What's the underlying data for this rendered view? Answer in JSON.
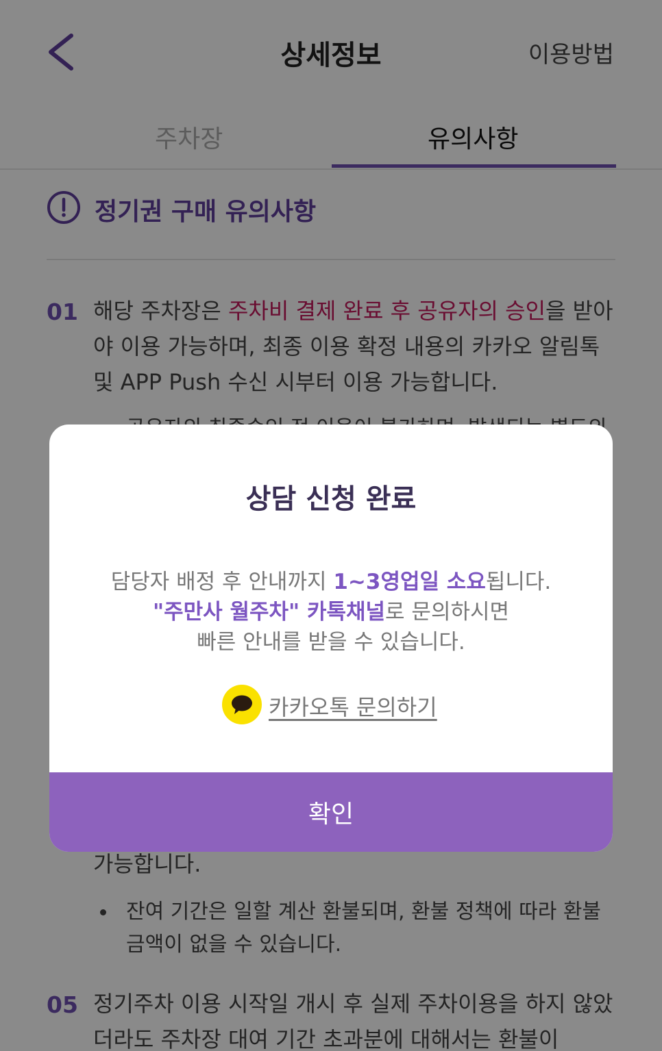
{
  "header": {
    "title": "상세정보",
    "right_link": "이용방법"
  },
  "tabs": [
    {
      "label": "주차장",
      "active": false
    },
    {
      "label": "유의사항",
      "active": true
    }
  ],
  "section": {
    "title": "정기권 구매 유의사항"
  },
  "notices": {
    "item1": {
      "number": "01",
      "text_before": "해당 주차장은 ",
      "text_highlight": "주차비 결제 완료 후 공유자의 승인",
      "text_after": "을 받아야 이용 가능하며, 최종 이용 확정 내용의 카카오 알림톡 및 APP Push 수신 시부터 이용 가능합니다.",
      "bullet_partial": "공유자의 최종승인 전 이용이 불가하며, 발생되는 별도의"
    },
    "item4": {
      "text_tail": "가능합니다.",
      "bullet": "잔여 기간은 일할 계산 환불되며, 환불 정책에 따라 환불 금액이 없을 수 있습니다."
    },
    "item5": {
      "number": "05",
      "text": "정기주차 이용 시작일 개시 후 실제 주차이용을 하지 않았더라도 주차장 대여 기간 초과분에 대해서는 환불이"
    }
  },
  "dialog": {
    "title": "상담 신청 완료",
    "line1_before": "담당자 배정 후 안내까지 ",
    "line1_highlight": "1~3영업일 소요",
    "line1_after": "됩니다.",
    "line2_highlight": "\"주만사 월주차\" 카톡채널",
    "line2_after": "로 문의하시면",
    "line3": "빠른 안내를 받을 수 있습니다.",
    "kakao_link": "카카오톡 문의하기",
    "confirm": "확인"
  },
  "colors": {
    "accent": "#6e4fb0",
    "confirm_button": "#8d62bd",
    "highlight_red": "#c2185b",
    "kakao_yellow": "#fae100"
  }
}
